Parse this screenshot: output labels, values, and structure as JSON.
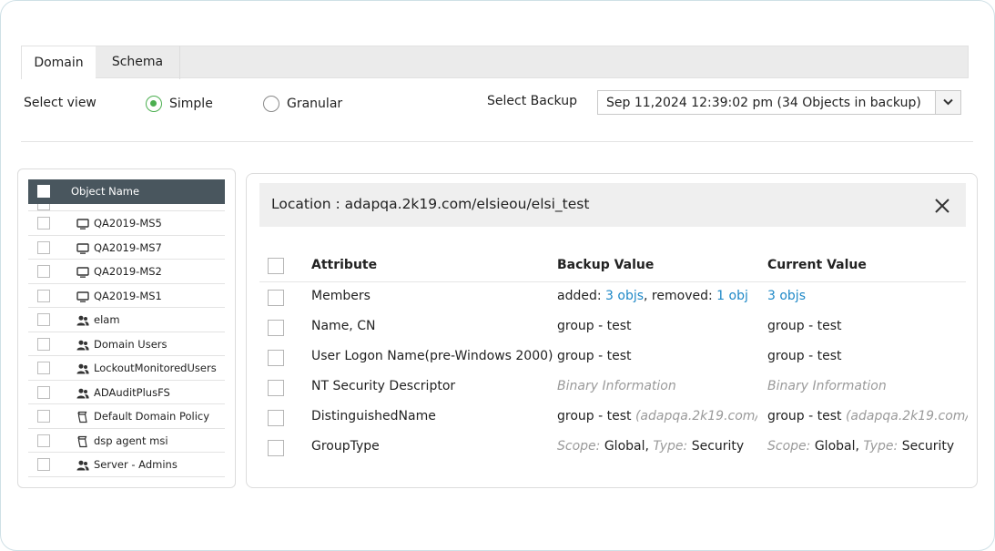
{
  "tabs": [
    {
      "label": "Domain",
      "active": true
    },
    {
      "label": "Schema",
      "active": false
    }
  ],
  "view": {
    "label": "Select view",
    "options": [
      {
        "label": "Simple",
        "checked": true
      },
      {
        "label": "Granular",
        "checked": false
      }
    ]
  },
  "backup": {
    "label": "Select Backup",
    "selected": "Sep 11,2024 12:39:02 pm (34 Objects in backup)"
  },
  "objects": {
    "header": "Object Name",
    "items": [
      {
        "name": "QA2019-MS5",
        "icon": "computer-icon"
      },
      {
        "name": "QA2019-MS7",
        "icon": "computer-icon"
      },
      {
        "name": "QA2019-MS2",
        "icon": "computer-icon"
      },
      {
        "name": "QA2019-MS1",
        "icon": "computer-icon"
      },
      {
        "name": "elam",
        "icon": "group-icon"
      },
      {
        "name": "Domain Users",
        "icon": "group-icon"
      },
      {
        "name": "LockoutMonitoredUsers",
        "icon": "group-icon"
      },
      {
        "name": "ADAuditPlusFS",
        "icon": "group-icon"
      },
      {
        "name": "Default Domain Policy",
        "icon": "policy-icon"
      },
      {
        "name": "dsp agent msi",
        "icon": "policy-icon"
      },
      {
        "name": "Server - Admins",
        "icon": "group-icon"
      }
    ]
  },
  "detail": {
    "location": "Location : adapqa.2k19.com/elsieou/elsi_test",
    "columns": {
      "attribute": "Attribute",
      "backup": "Backup Value",
      "current": "Current Value"
    },
    "rows": {
      "members": {
        "attribute": "Members",
        "added_label": "added:",
        "added_link": "3 objs",
        "removed_label": ", removed:",
        "removed_link": "1 obj",
        "current_link": "3 objs"
      },
      "name_cn": {
        "attribute": "Name, CN",
        "backup": "group - test",
        "current": "group - test"
      },
      "logon": {
        "attribute": "User Logon Name(pre-Windows 2000)",
        "backup": "group - test",
        "current": "group - test"
      },
      "nt": {
        "attribute": "NT Security Descriptor",
        "backup": "Binary Information",
        "current": "Binary Information"
      },
      "dn": {
        "attribute": "DistinguishedName",
        "backup": "group - test",
        "backup_path": "(adapqa.2k19.com/",
        "current": "group - test",
        "current_path": "(adapqa.2k19.com/"
      },
      "grouptype": {
        "attribute": "GroupType",
        "scope_label": "Scope:",
        "scope": "Global,",
        "type_label": "Type:",
        "type": "Security"
      }
    }
  },
  "colors": {
    "accent": "#4caf50",
    "link": "#1e88c7",
    "header_bg": "#49565e"
  }
}
